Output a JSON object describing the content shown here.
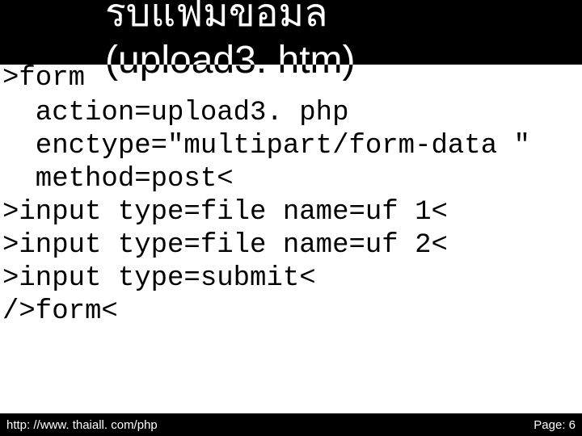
{
  "title": {
    "line1": "รบแฟมขอมล",
    "line2": "(upload3. htm)"
  },
  "form_label": ">form",
  "code_lines": [
    "  action=upload3. php",
    "  enctype=\"multipart/form-data \"",
    "  method=post<",
    ">input type=file name=uf 1<",
    ">input type=file name=uf 2<",
    ">input type=submit<",
    "/>form<"
  ],
  "footer": {
    "url": "http: //www. thaiall. com/php",
    "page_label": "Page: 6"
  }
}
